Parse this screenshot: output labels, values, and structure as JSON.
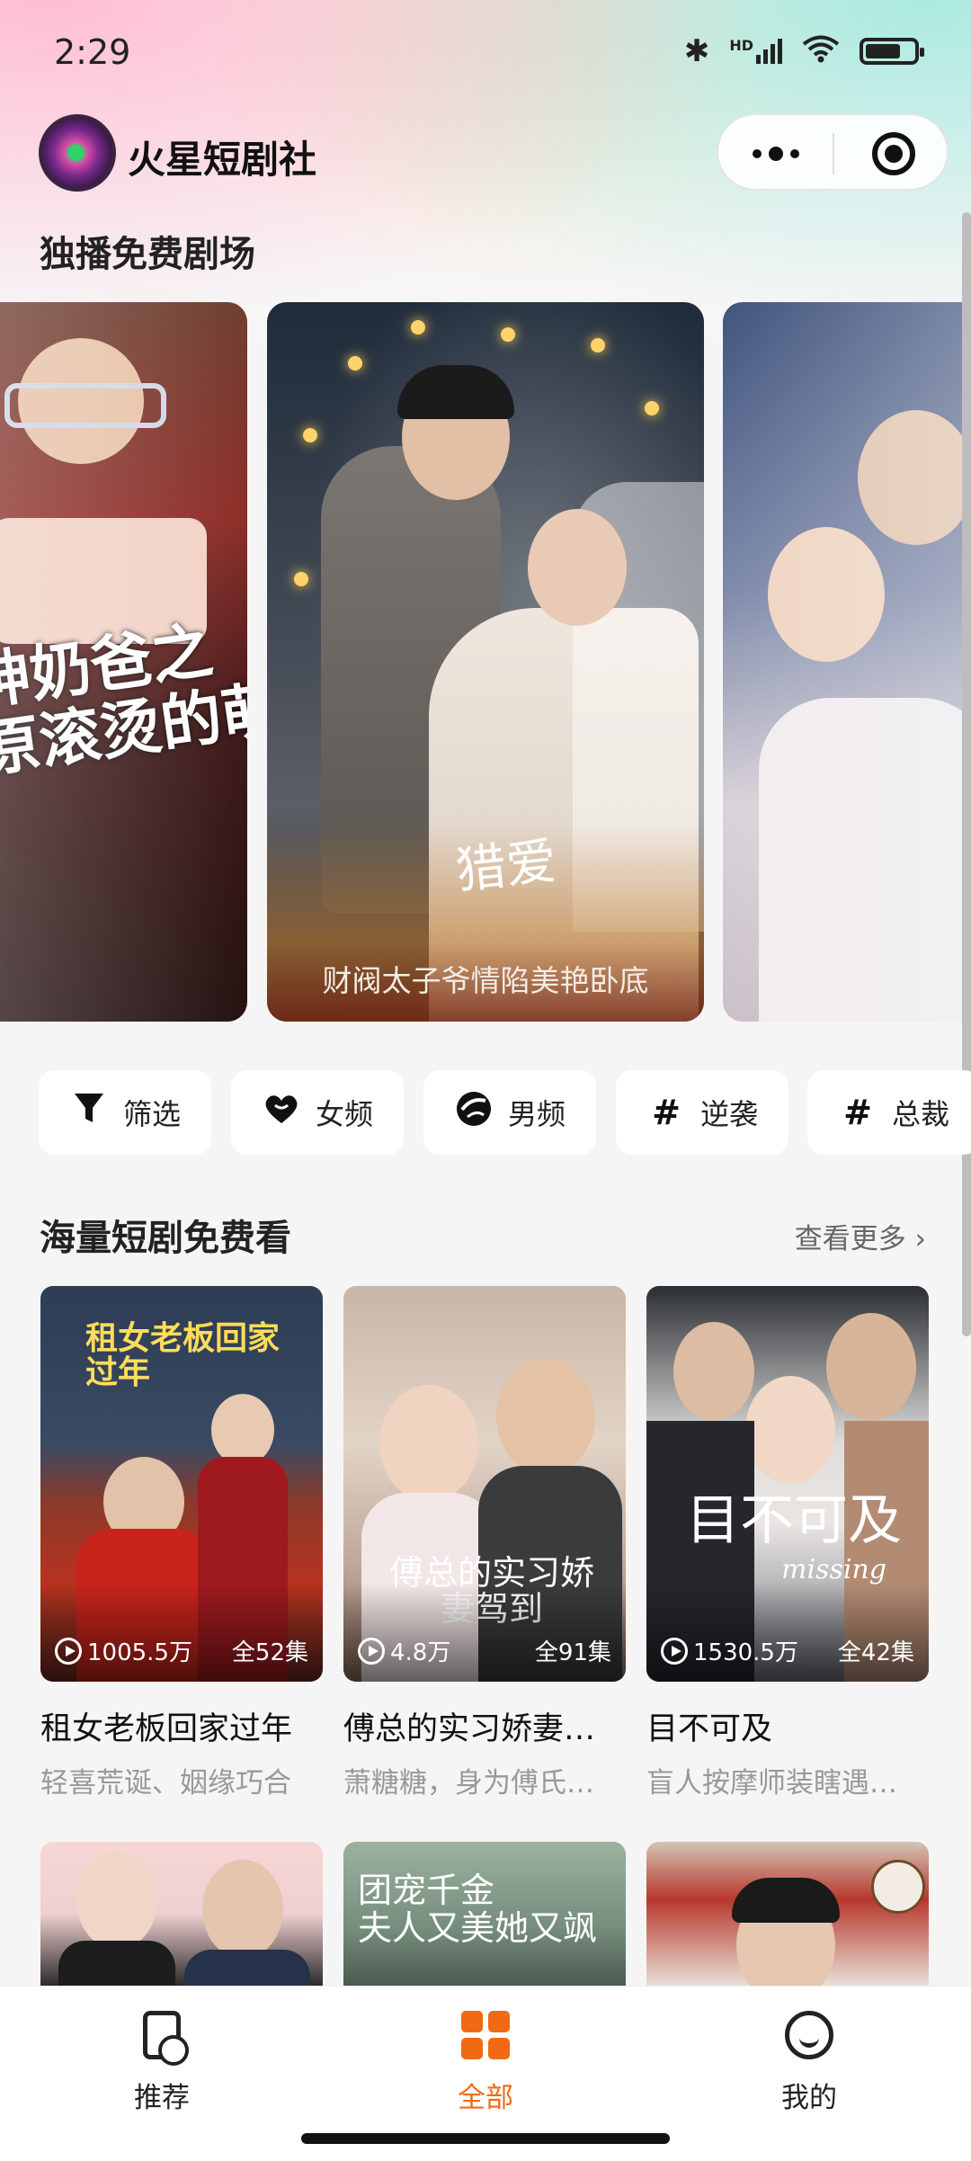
{
  "status_bar": {
    "time": "2:29",
    "icons": [
      "bluetooth-icon",
      "signal-icon",
      "wifi-icon",
      "battery-icon"
    ],
    "signal_label": "HD"
  },
  "header": {
    "app_name": "火星短剧社"
  },
  "featured": {
    "title": "独播免费剧场",
    "center_poster": {
      "calligraphy": "猎爱",
      "caption": "财阀太子爷情陷美艳卧底"
    },
    "left_poster": {
      "text": "神奶爸之\n原滚烫的萌娃"
    }
  },
  "chips": [
    {
      "icon": "filter-icon",
      "label": "筛选"
    },
    {
      "icon": "heart-icon",
      "label": "女频"
    },
    {
      "icon": "male-icon",
      "label": "男频"
    },
    {
      "icon": "hash-icon",
      "label": "逆袭"
    },
    {
      "icon": "hash-icon",
      "label": "总裁"
    }
  ],
  "section2": {
    "title": "海量短剧免费看",
    "more": "查看更多 ›",
    "items": [
      {
        "views": "1005.5万",
        "episodes": "全52集",
        "name": "租女老板回家过年",
        "desc": "轻喜荒诞、姻缘巧合",
        "overlay": "租女老板回家过年"
      },
      {
        "views": "4.8万",
        "episodes": "全91集",
        "name": "傅总的实习娇妻…",
        "desc": "萧糖糖，身为傅氏…",
        "overlay": "傅总的实习娇妻驾到"
      },
      {
        "views": "1530.5万",
        "episodes": "全42集",
        "name": "目不可及",
        "desc": "盲人按摩师装瞎遇…",
        "overlay": "目不可及",
        "overlay_en": "missing"
      }
    ],
    "row2_overlays": [
      "",
      "团宠千金\n夫人又美她又飒",
      ""
    ]
  },
  "bottom_nav": {
    "items": [
      {
        "icon": "recommend-icon",
        "label": "推荐",
        "active": false
      },
      {
        "icon": "grid-icon",
        "label": "全部",
        "active": true
      },
      {
        "icon": "smile-icon",
        "label": "我的",
        "active": false
      }
    ],
    "active_color": "#f06a14"
  }
}
